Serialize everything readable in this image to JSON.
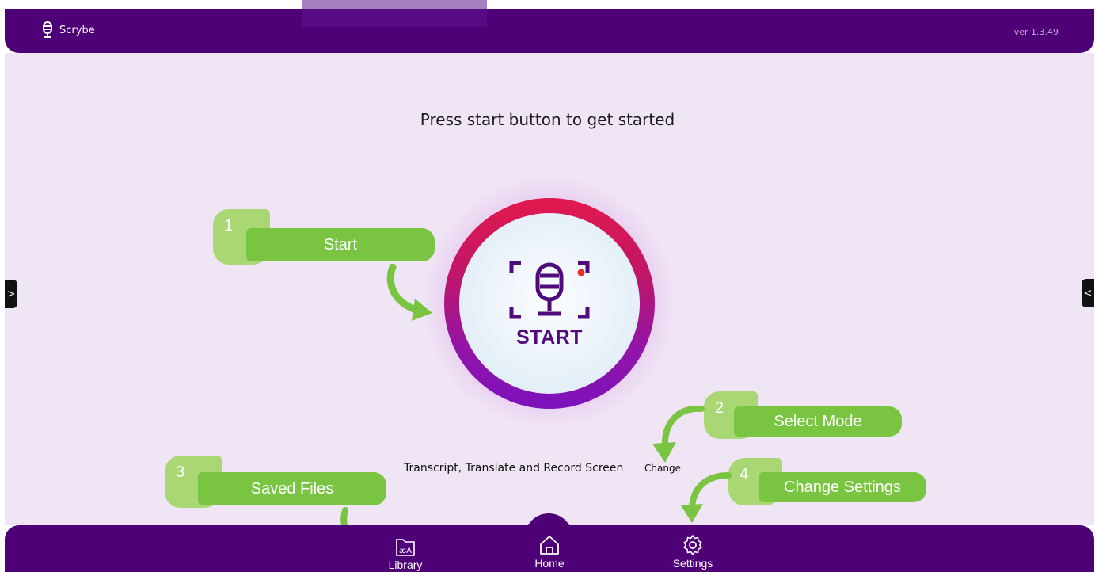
{
  "app": {
    "name": "Scrybe",
    "version": "ver 1.3.49"
  },
  "main": {
    "heading": "Press start button to get started",
    "start_button_label": "START",
    "mode_text": "Transcript, Translate and Record Screen",
    "change_label": "Change"
  },
  "callouts": [
    {
      "number": "1",
      "label": "Start"
    },
    {
      "number": "2",
      "label": "Select Mode"
    },
    {
      "number": "3",
      "label": "Saved Files"
    },
    {
      "number": "4",
      "label": "Change Settings"
    }
  ],
  "bottom_nav": [
    {
      "label": "Library",
      "icon": "library-icon"
    },
    {
      "label": "Home",
      "icon": "home-icon"
    },
    {
      "label": "Settings",
      "icon": "settings-icon"
    }
  ],
  "side_toggles": {
    "left": ">",
    "right": "<"
  },
  "colors": {
    "header": "#4e0177",
    "background": "#f0e5f4",
    "callout_green": "#79c541",
    "callout_number": "#a9d774",
    "start_text": "#4f0a7b",
    "ring_top": "#e2194d",
    "ring_bottom": "#7c12bb",
    "record_dot": "#e0302f"
  }
}
